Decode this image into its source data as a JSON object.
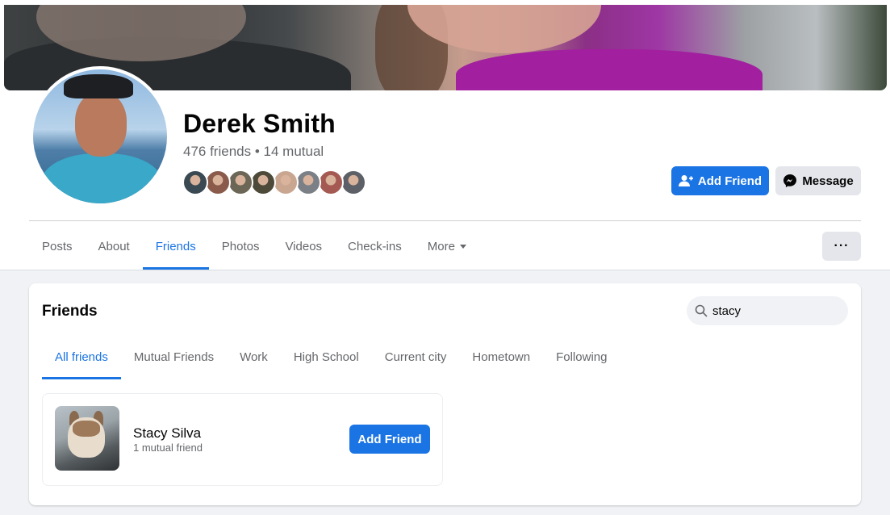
{
  "profile": {
    "name": "Derek Smith",
    "friends_count": "476 friends",
    "separator": " • ",
    "mutual": "14 mutual",
    "mutual_friend_colors": [
      "#3b4a52",
      "#8a5b4a",
      "#6b6656",
      "#4d4a3a",
      "#c9a690",
      "#7b7f86",
      "#a45a52",
      "#5d6066"
    ]
  },
  "actions": {
    "add_friend": "Add Friend",
    "message": "Message",
    "more_options": "···"
  },
  "nav": {
    "tabs": [
      {
        "label": "Posts"
      },
      {
        "label": "About"
      },
      {
        "label": "Friends",
        "active": true
      },
      {
        "label": "Photos"
      },
      {
        "label": "Videos"
      },
      {
        "label": "Check-ins"
      },
      {
        "label": "More"
      }
    ]
  },
  "friends_section": {
    "title": "Friends",
    "search_value": "stacy",
    "subtabs": [
      {
        "label": "All friends",
        "active": true
      },
      {
        "label": "Mutual Friends"
      },
      {
        "label": "Work"
      },
      {
        "label": "High School"
      },
      {
        "label": "Current city"
      },
      {
        "label": "Hometown"
      },
      {
        "label": "Following"
      }
    ],
    "results": [
      {
        "name": "Stacy Silva",
        "mutual": "1 mutual friend",
        "action": "Add Friend"
      }
    ]
  },
  "colors": {
    "accent": "#1b74e4",
    "secondary_text": "#65676b",
    "page_bg": "#f0f2f5"
  }
}
